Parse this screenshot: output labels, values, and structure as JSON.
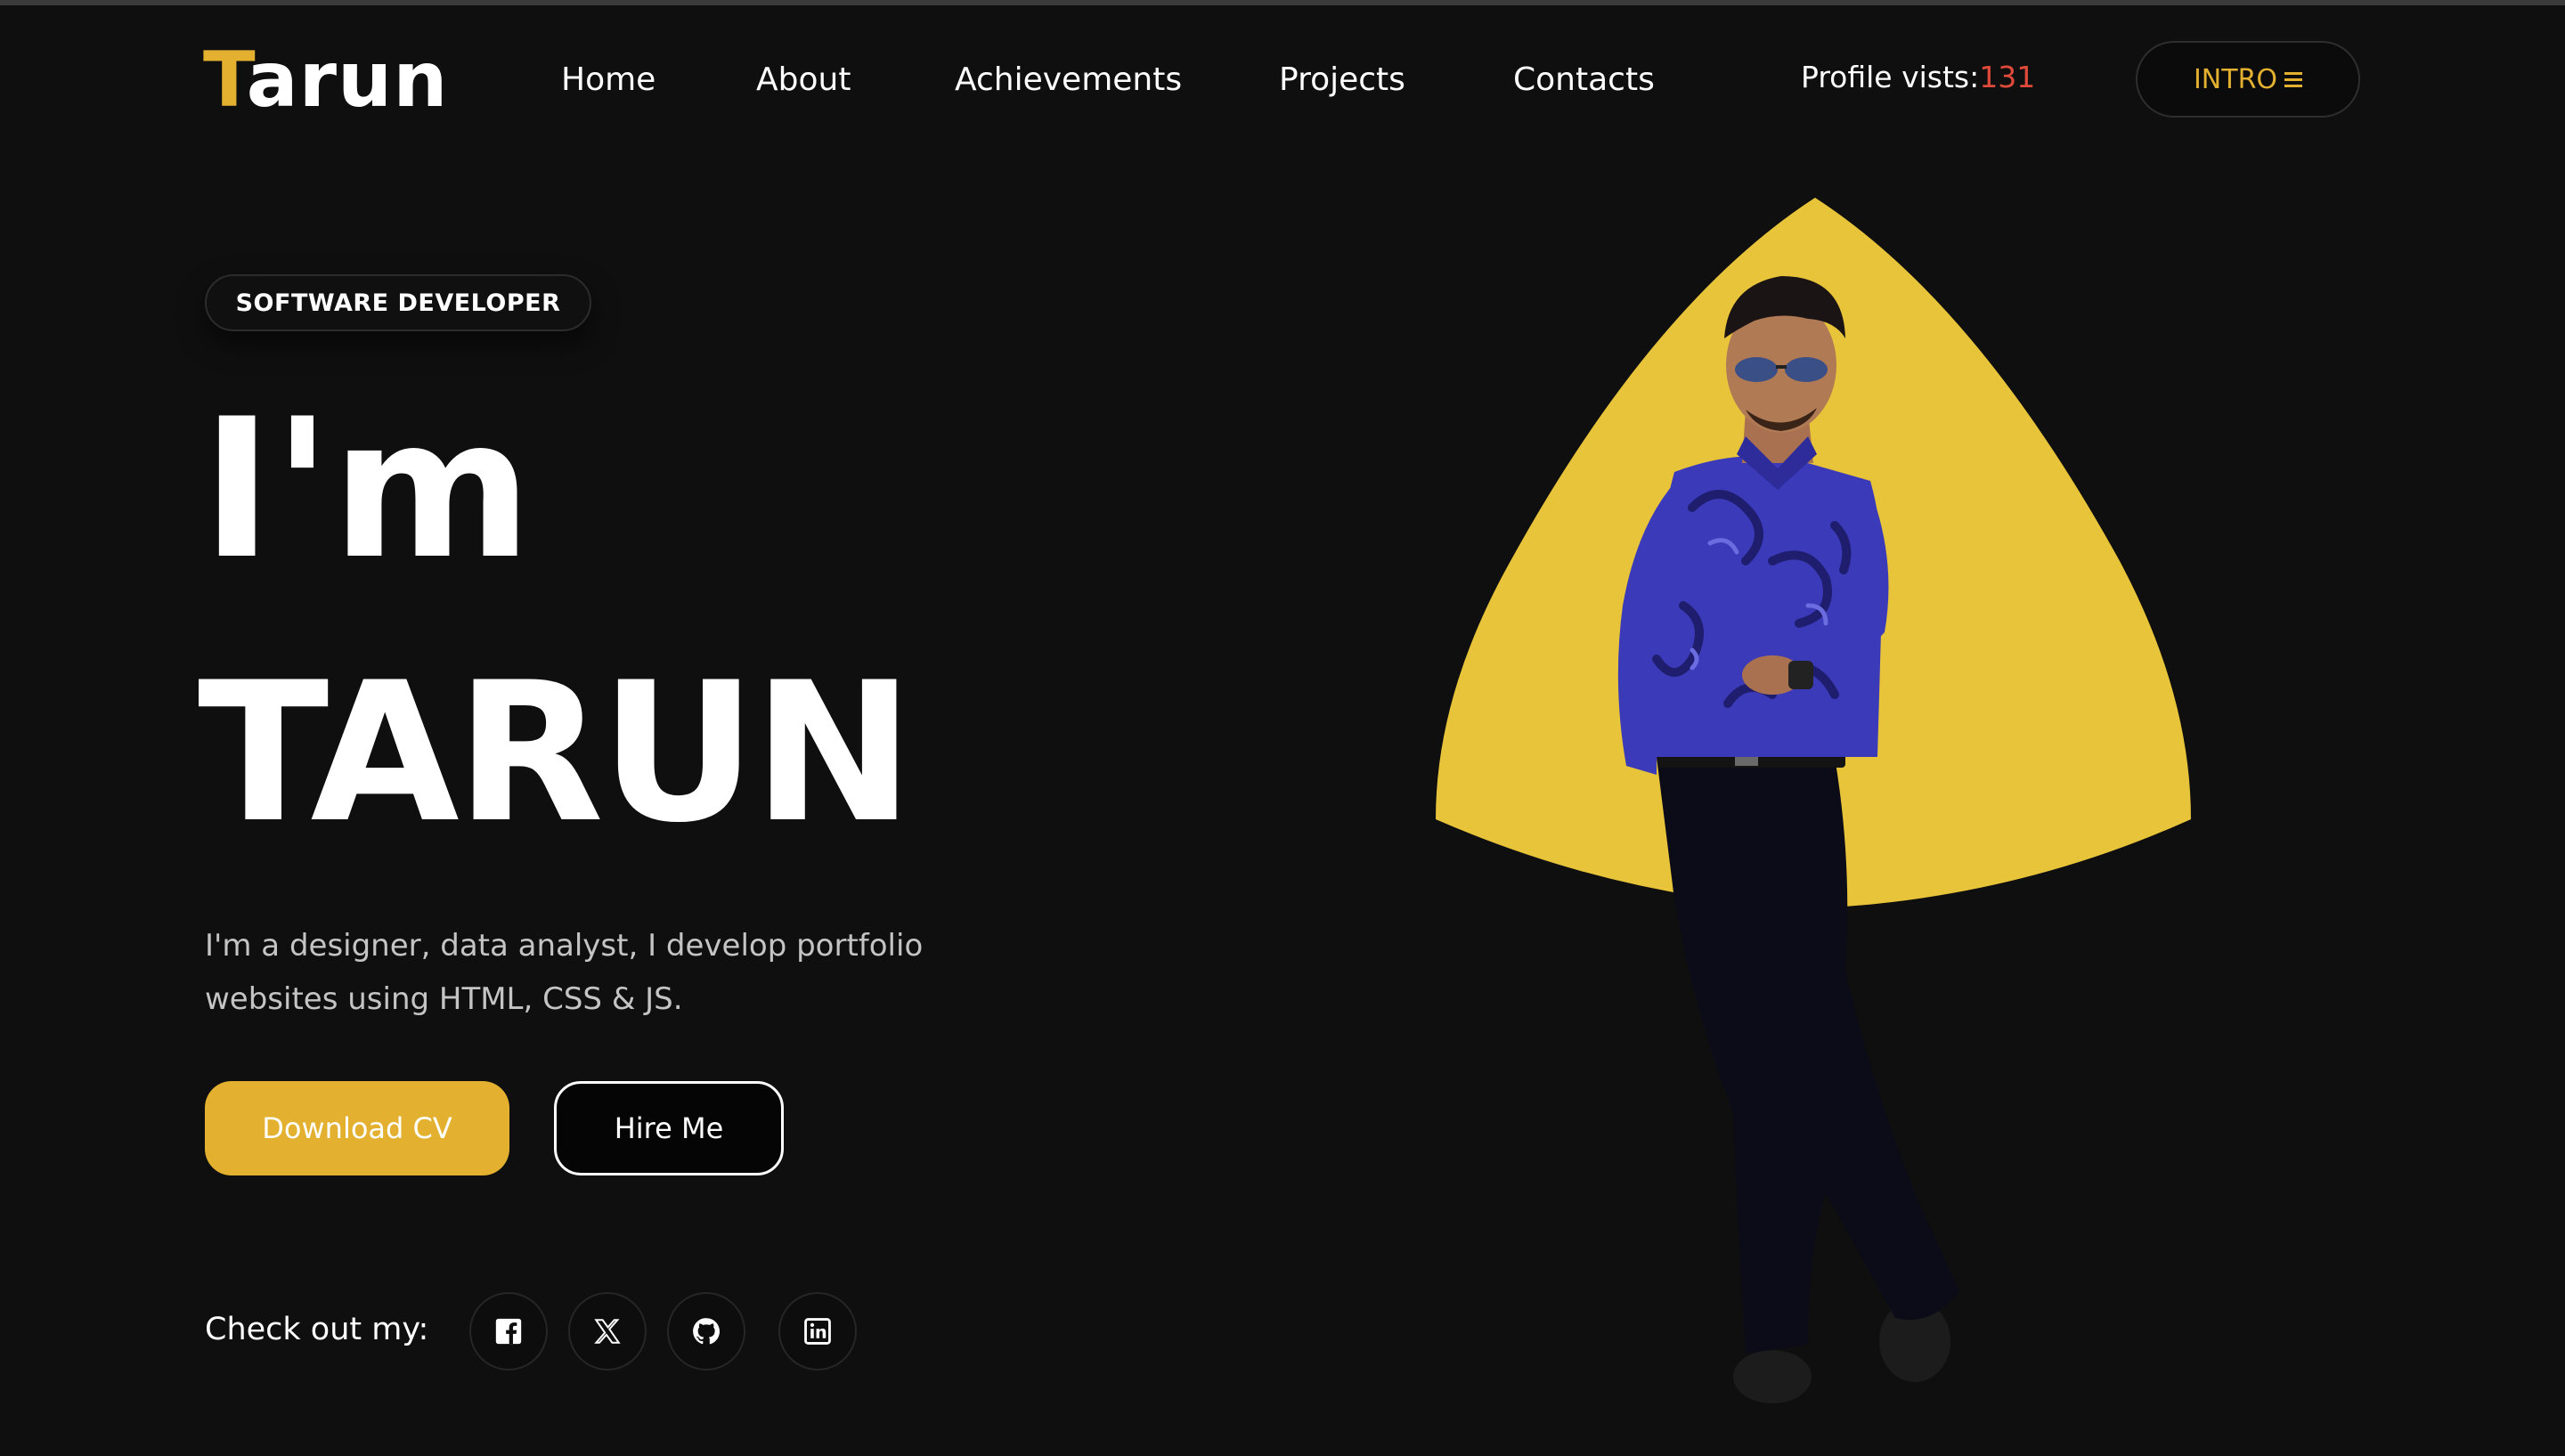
{
  "header": {
    "logo_first": "T",
    "logo_rest": "arun",
    "nav": [
      "Home",
      "About",
      "Achievements",
      "Projects",
      "Contacts"
    ],
    "visits_label": "Profile vists:",
    "visits_count": "131",
    "intro_label": "INTRO"
  },
  "hero": {
    "badge": "SOFTWARE DEVELOPER",
    "headline_line1": "I'm",
    "headline_line2": "TARUN",
    "description": "I'm a designer, data analyst, I develop portfolio websites using HTML, CSS & JS.",
    "download_cv": "Download CV",
    "hire_me": "Hire Me",
    "social_label": "Check out my:",
    "socials": [
      "facebook-icon",
      "x-icon",
      "github-icon",
      "linkedin-icon"
    ]
  },
  "colors": {
    "accent": "#e3b12f",
    "triangle": "#e8c43a",
    "visits": "#e04a3a",
    "background": "#0f0f0f"
  }
}
